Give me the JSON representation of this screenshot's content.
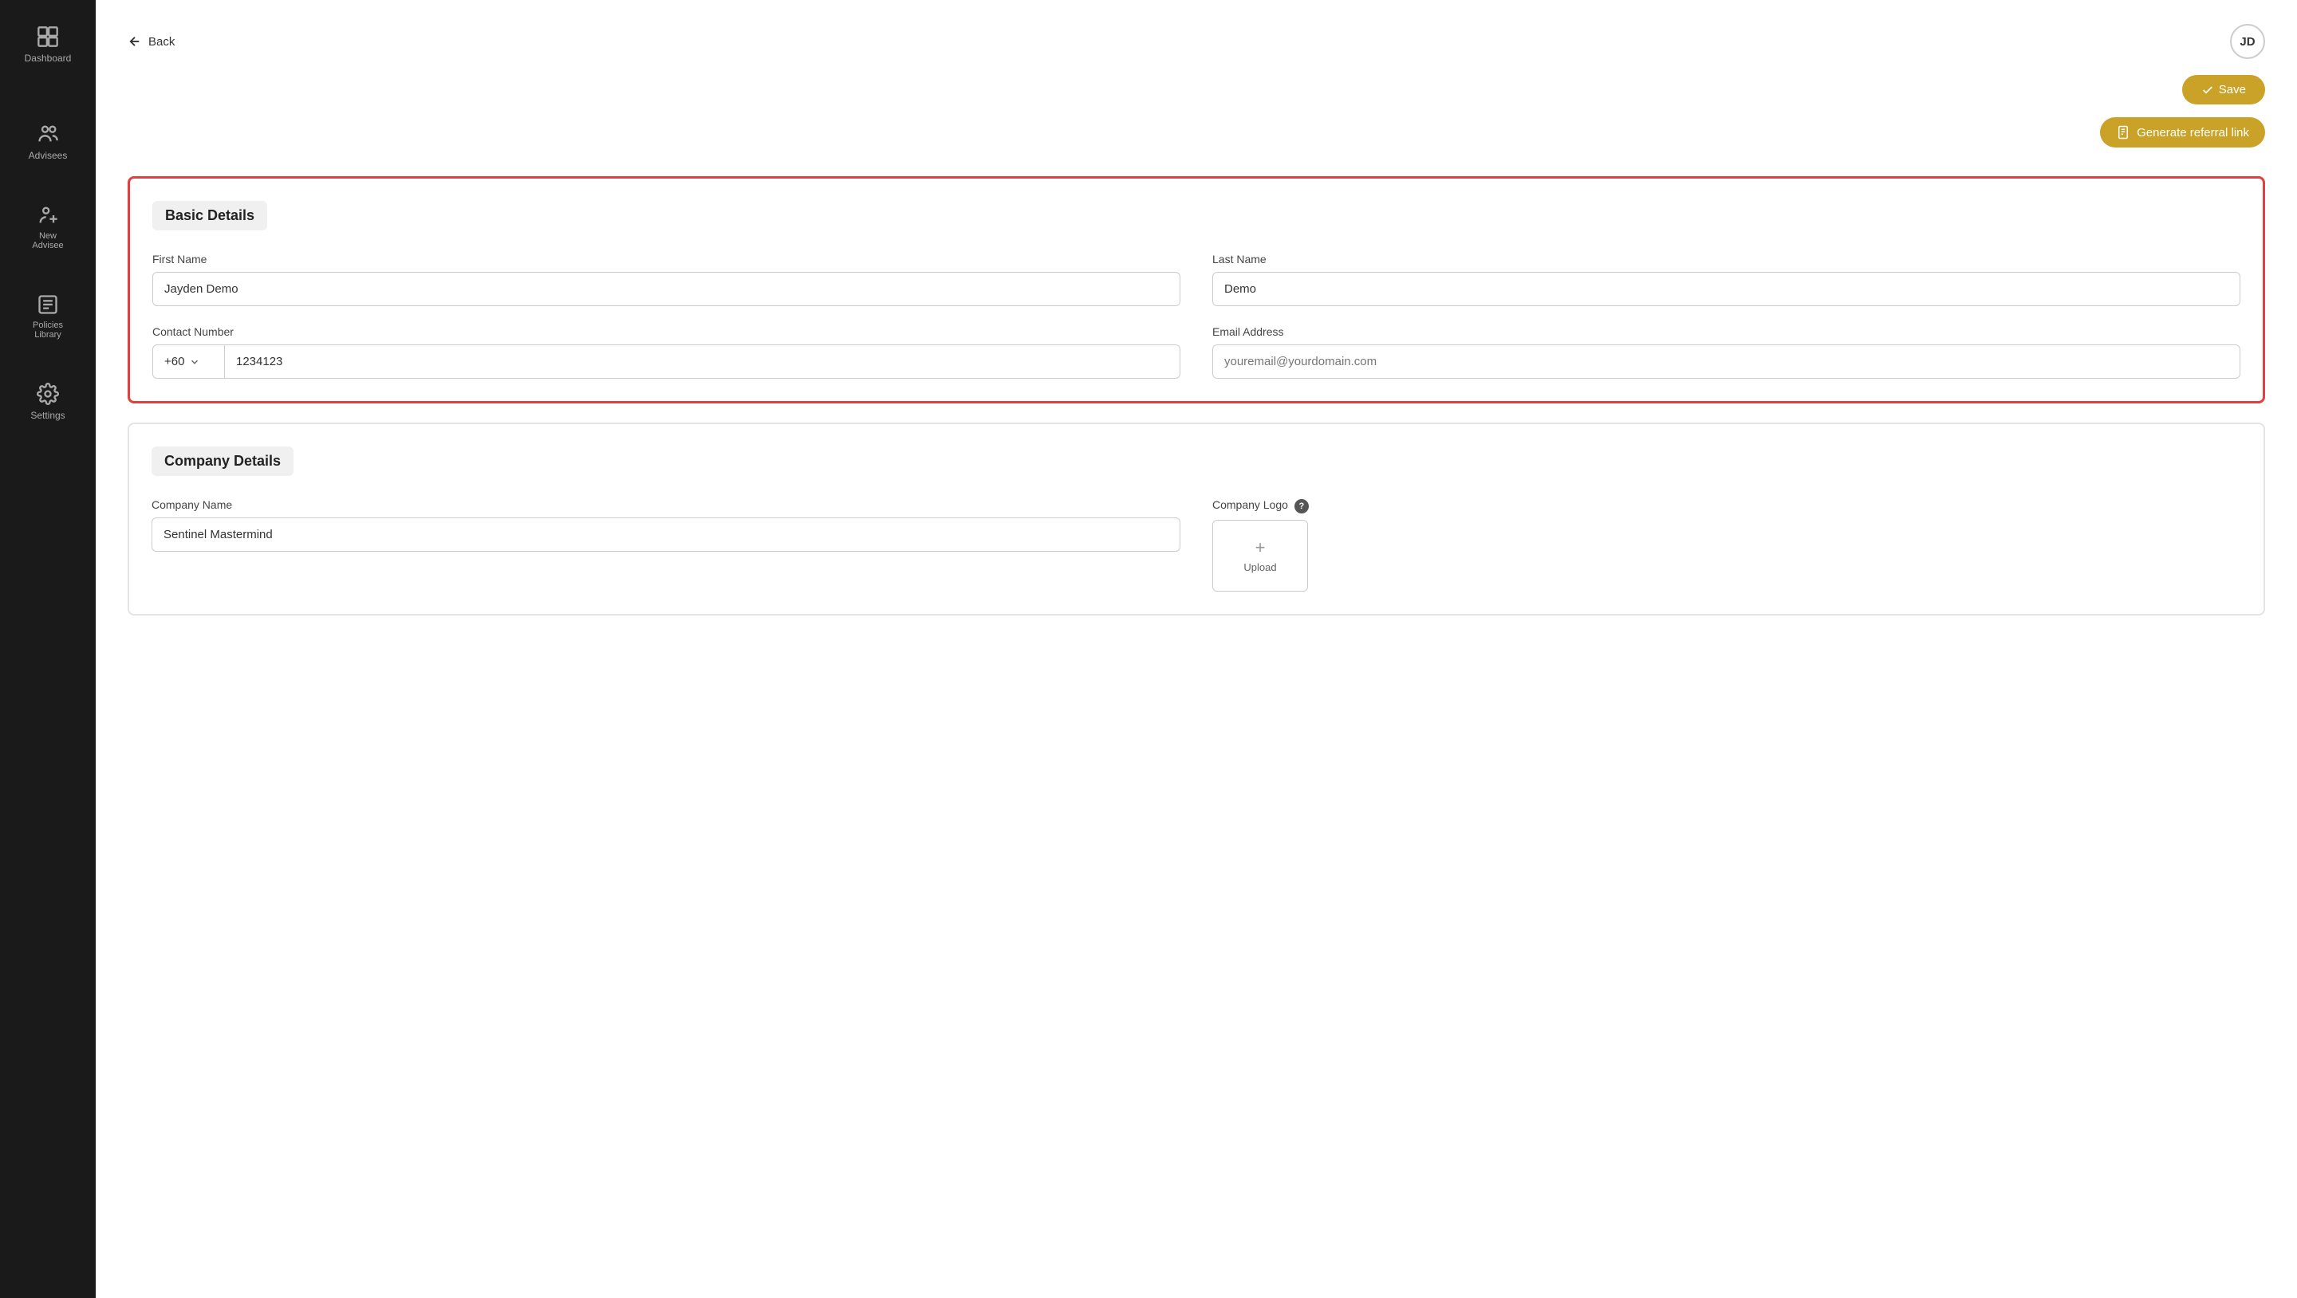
{
  "sidebar": {
    "items": [
      {
        "id": "dashboard",
        "label": "Dashboard",
        "icon": "dashboard-icon"
      },
      {
        "id": "advisees",
        "label": "Advisees",
        "icon": "advisees-icon"
      },
      {
        "id": "new-advisee",
        "label": "New Advisee",
        "icon": "new-advisee-icon"
      },
      {
        "id": "policies-library",
        "label": "Policies Library",
        "icon": "policies-icon"
      },
      {
        "id": "settings",
        "label": "Settings",
        "icon": "settings-icon"
      }
    ]
  },
  "header": {
    "back_label": "Back",
    "avatar_initials": "JD",
    "save_label": "Save"
  },
  "action_bar": {
    "generate_label": "Generate referral link"
  },
  "basic_details": {
    "title": "Basic Details",
    "first_name_label": "First Name",
    "first_name_value": "Jayden Demo",
    "last_name_label": "Last Name",
    "last_name_value": "Demo",
    "contact_label": "Contact Number",
    "phone_code": "+60",
    "phone_number": "1234123",
    "email_label": "Email Address",
    "email_placeholder": "youremail@yourdomain.com"
  },
  "company_details": {
    "title": "Company Details",
    "company_name_label": "Company Name",
    "company_name_value": "Sentinel Mastermind",
    "company_logo_label": "Company Logo",
    "upload_label": "Upload"
  }
}
